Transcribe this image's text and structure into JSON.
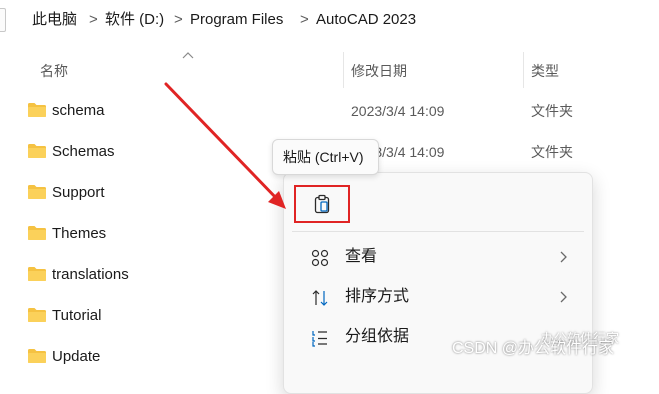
{
  "breadcrumb": {
    "items": [
      "此电脑",
      "软件 (D:)",
      "Program Files",
      "AutoCAD 2023"
    ],
    "separator": ">"
  },
  "columns": {
    "name": "名称",
    "modified": "修改日期",
    "type": "类型"
  },
  "rows": [
    {
      "name": "schema",
      "modified": "2023/3/4 14:09",
      "type": "文件夹"
    },
    {
      "name": "Schemas",
      "modified": "2023/3/4 14:09",
      "type": "文件夹"
    },
    {
      "name": "Support",
      "modified": "",
      "type": ""
    },
    {
      "name": "Themes",
      "modified": "",
      "type": ""
    },
    {
      "name": "translations",
      "modified": "",
      "type": ""
    },
    {
      "name": "Tutorial",
      "modified": "",
      "type": ""
    },
    {
      "name": "Update",
      "modified": "",
      "type": ""
    }
  ],
  "tooltip": {
    "text": "粘贴 (Ctrl+V)"
  },
  "context_menu": {
    "paste_icon": "paste-icon",
    "items": [
      {
        "label": "查看",
        "icon": "view-grid-icon",
        "has_submenu": true
      },
      {
        "label": "排序方式",
        "icon": "sort-icon",
        "has_submenu": true
      },
      {
        "label": "分组依据",
        "icon": "group-list-icon",
        "has_submenu": false
      }
    ]
  },
  "watermark": {
    "text": "CSDN @办公软件行家",
    "secondary": "办公软件行家"
  },
  "colors": {
    "folder": "#f5c242",
    "annotation_red": "#e02424",
    "accent": "#0067c0"
  }
}
